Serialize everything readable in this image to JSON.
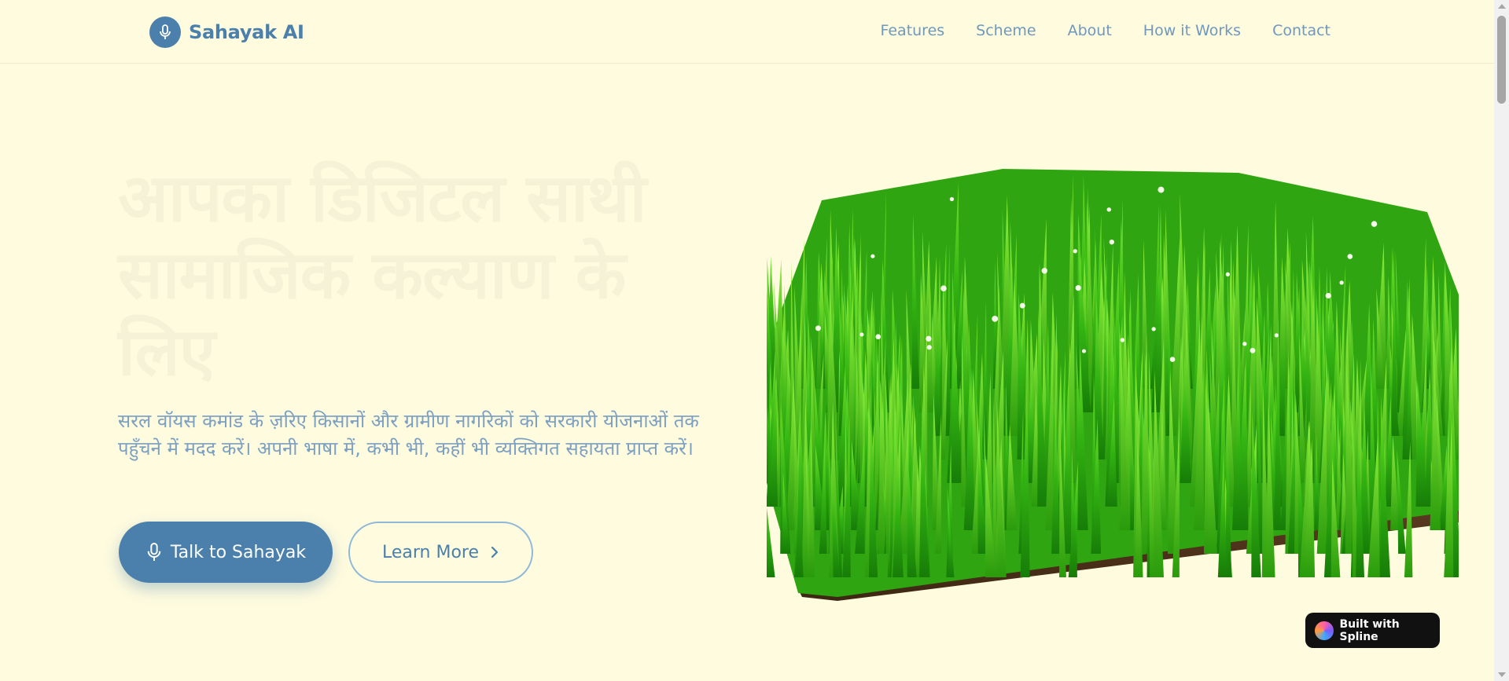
{
  "brand": {
    "name": "Sahayak AI",
    "logo_icon": "mic-icon",
    "color": "#4a80ab"
  },
  "nav": {
    "items": [
      {
        "label": "Features"
      },
      {
        "label": "Scheme"
      },
      {
        "label": "About"
      },
      {
        "label": "How it Works"
      },
      {
        "label": "Contact"
      }
    ]
  },
  "hero": {
    "title": "आपका डिजिटल साथी सामाजिक कल्याण के लिए",
    "description": "सरल वॉयस कमांड के ज़रिए किसानों और ग्रामीण नागरिकों को सरकारी योजनाओं तक पहुँचने में मदद करें। अपनी भाषा में, कभी भी, कहीं भी व्यक्तिगत सहायता प्राप्त करें।",
    "primary_cta": {
      "label": "Talk to Sahayak",
      "icon": "mic-icon"
    },
    "secondary_cta": {
      "label": "Learn More",
      "icon": "chevron-right-icon"
    }
  },
  "scene": {
    "description_icon": "grass-3d-scene"
  },
  "badge": {
    "label": "Built with Spline"
  },
  "colors": {
    "background": "#fefbdf",
    "accent": "#4a80ab",
    "nav_text": "#6f98bd",
    "grass": "#3fbf14"
  }
}
